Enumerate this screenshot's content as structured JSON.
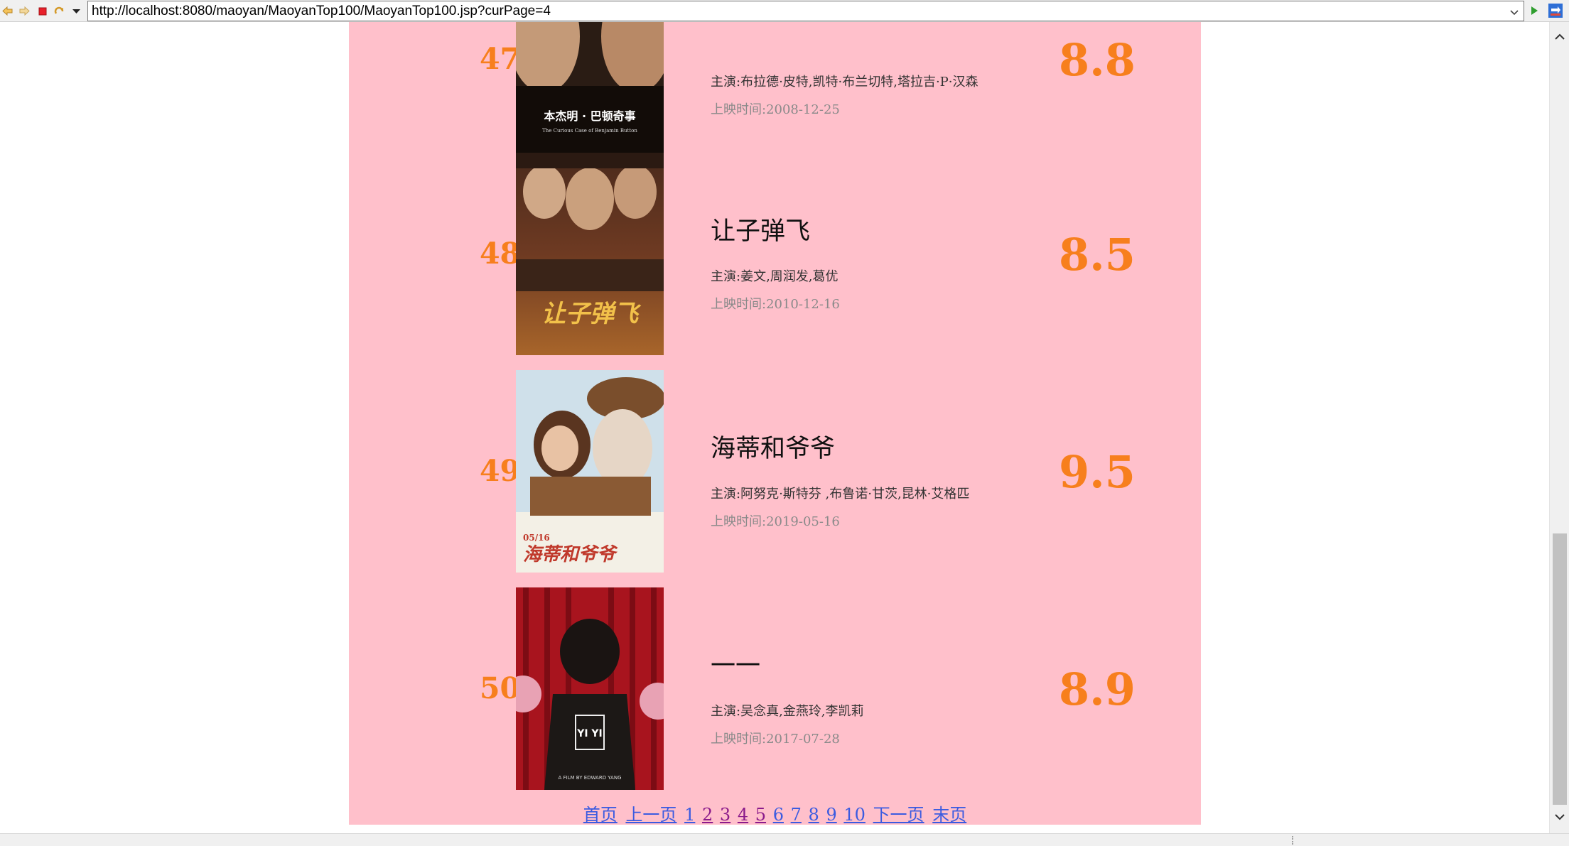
{
  "browser": {
    "url": "http://localhost:8080/maoyan/MaoyanTop100/MaoyanTop100.jsp?curPage=4",
    "icons": [
      "back-icon",
      "forward-icon",
      "stop-icon",
      "refresh-icon",
      "menu-icon",
      "dropdown-icon",
      "go-icon",
      "switch-icon"
    ]
  },
  "movies": [
    {
      "rank": "47",
      "title": "",
      "actors": "主演:布拉德·皮特,凯特·布兰切特,塔拉吉·P·汉森",
      "release": "上映时间:2008-12-25",
      "score": "8.8",
      "poster_text": "本杰明 · 巴顿奇事",
      "poster_subtext": "The Curious Case of Benjamin Button"
    },
    {
      "rank": "48",
      "title": "让子弹飞",
      "actors": "主演:姜文,周润发,葛优",
      "release": "上映时间:2010-12-16",
      "score": "8.5",
      "poster_text": "让子弹飞"
    },
    {
      "rank": "49",
      "title": "海蒂和爷爷",
      "actors": "主演:阿努克·斯特芬 ,布鲁诺·甘茨,昆林·艾格匹",
      "release": "上映时间:2019-05-16",
      "score": "9.5",
      "poster_text": "海蒂和爷爷",
      "poster_date": "05/16"
    },
    {
      "rank": "50",
      "title": "一一",
      "actors": "主演:吴念真,金燕玲,李凯莉",
      "release": "上映时间:2017-07-28",
      "score": "8.9",
      "poster_text": "YI YI",
      "poster_subtext": "A FILM BY EDWARD YANG"
    }
  ],
  "pager": {
    "first": "首页",
    "prev": "上一页",
    "pages": [
      "1",
      "2",
      "3",
      "4",
      "5",
      "6",
      "7",
      "8",
      "9",
      "10"
    ],
    "next": "下一页",
    "last": "末页"
  },
  "colors": {
    "page_bg": "#ffc0cb",
    "accent": "#f77f1d",
    "link": "#3b5be0",
    "visited": "#8b1a8b"
  }
}
